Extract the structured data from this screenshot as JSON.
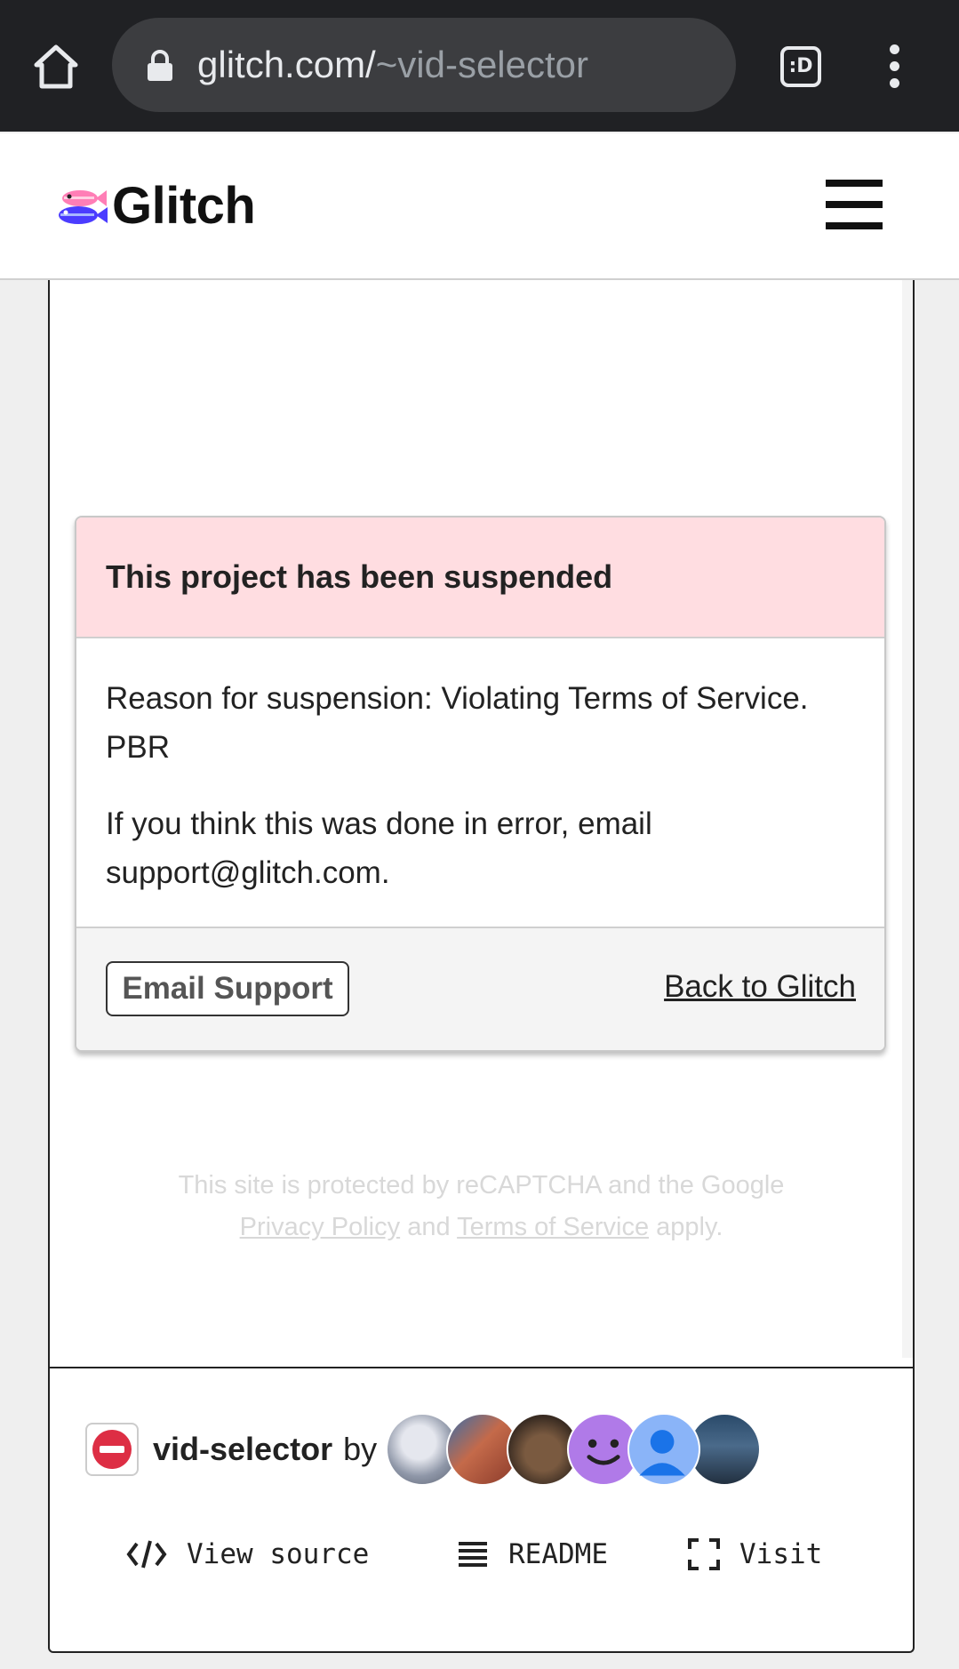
{
  "browser": {
    "url_host": "glitch.com/",
    "url_path": "~vid-selector",
    "tab_count": ":D"
  },
  "header": {
    "logo_text": "Glitch"
  },
  "suspension": {
    "title": "This project has been suspended",
    "reason": "Reason for suspension: Violating Terms of Service. PBR",
    "contact": "If you think this was done in error, email support@glitch.com.",
    "email_button": "Email Support",
    "back_link": "Back to Glitch"
  },
  "recaptcha": {
    "line1": "This site is protected by reCAPTCHA and the Google",
    "privacy": "Privacy Policy",
    "and": "and",
    "terms": "Terms of Service",
    "apply": "apply."
  },
  "project": {
    "name": "vid-selector",
    "by": "by",
    "avatar_colors": [
      "#8f97a8",
      "#b85a3c",
      "#4a3a30",
      "#b07ae8",
      "#8ab4f8",
      "#3a4f66"
    ]
  },
  "actions": {
    "view_source": "View source",
    "readme": "README",
    "visit": "Visit"
  }
}
